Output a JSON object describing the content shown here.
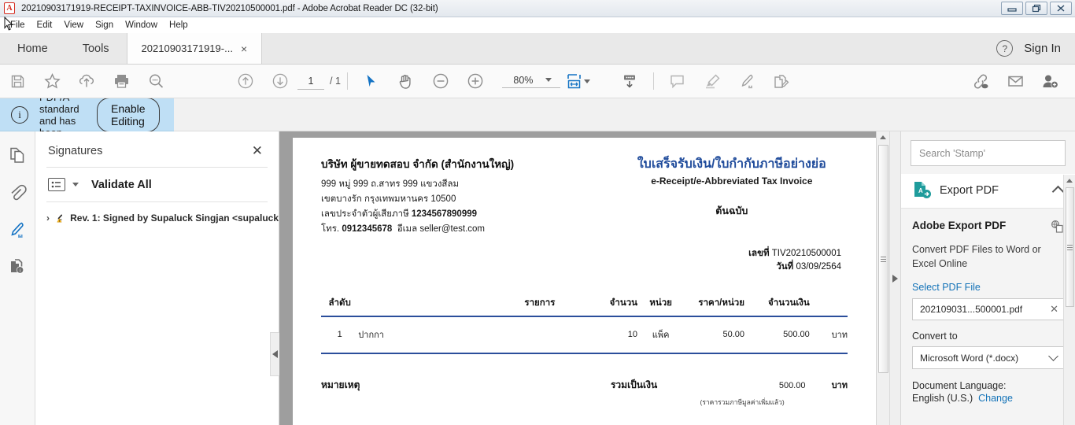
{
  "window": {
    "title": "20210903171919-RECEIPT-TAXINVOICE-ABB-TIV20210500001.pdf - Adobe Acrobat Reader DC (32-bit)",
    "app_icon": "acrobat-logo",
    "minimize": "minimize-button",
    "restore": "restore-button",
    "close": "close-button"
  },
  "menubar": {
    "items": [
      {
        "label": "File"
      },
      {
        "label": "Edit"
      },
      {
        "label": "View"
      },
      {
        "label": "Sign"
      },
      {
        "label": "Window"
      },
      {
        "label": "Help"
      }
    ]
  },
  "tabbar": {
    "home": "Home",
    "tools": "Tools",
    "doc_tab": "20210903171919-...",
    "doc_tab_close": "×",
    "help": "?",
    "sign_in": "Sign In"
  },
  "toolbar": {
    "page_current": "1",
    "page_total": "/ 1",
    "zoom_level": "80%",
    "icons": [
      "save-icon",
      "star-icon",
      "upload-cloud-icon",
      "print-icon",
      "search-icon",
      "previous-page-icon",
      "next-page-icon",
      "select-tool-icon",
      "hand-tool-icon",
      "zoom-out-icon",
      "zoom-in-icon",
      "fit-page-icon",
      "download-icon",
      "comment-icon",
      "highlight-icon",
      "sign-icon",
      "request-signature-icon",
      "share-link-icon",
      "email-icon",
      "add-person-icon"
    ]
  },
  "notification": {
    "message": "This file claims compliance with the PDF/A standard and has been opened read-only to prevent modification.",
    "button": "Enable Editing",
    "icon": "info-icon",
    "background": "#bfdff5"
  },
  "rail": {
    "items": [
      {
        "name": "page-thumbnails-icon",
        "active": false
      },
      {
        "name": "attachments-icon",
        "active": false
      },
      {
        "name": "signatures-icon",
        "active": true
      },
      {
        "name": "document-info-icon",
        "active": false
      }
    ]
  },
  "signatures_panel": {
    "title": "Signatures",
    "close": "✕",
    "validate_all": "Validate All",
    "expander": "›",
    "entry": "Rev. 1: Signed by Supaluck Singjan <supaluck"
  },
  "document": {
    "seller": {
      "name": "บริษัท ผู้ขายทดสอบ จำกัด (สำนักงานใหญ่)",
      "address_line1": "999 หมู่ 999 ถ.สาทร 999 แขวงสีลม",
      "address_line2": "เขตบางรัก กรุงเทพมหานคร 10500",
      "tax_id_label": "เลขประจำตัวผู้เสียภาษี",
      "tax_id": "1234567890999",
      "phone_label": "โทร.",
      "phone": "0912345678",
      "email_label": "อีเมล",
      "email": "seller@test.com"
    },
    "header": {
      "title_th": "ใบเสร็จรับเงิน/ใบกำกับภาษีอย่างย่อ",
      "title_en": "e-Receipt/e-Abbreviated Tax Invoice",
      "original": "ต้นฉบับ",
      "doc_no_label": "เลขที่",
      "doc_no": "TIV20210500001",
      "date_label": "วันที่",
      "date": "03/09/2564"
    },
    "table": {
      "headers": {
        "no": "ลำดับ",
        "description": "รายการ",
        "quantity": "จำนวน",
        "unit": "หน่วย",
        "price_per_unit": "ราคา/หน่วย",
        "amount": "จำนวนเงิน"
      },
      "rows": [
        {
          "no": "1",
          "description": "ปากกา",
          "quantity": "10",
          "unit": "แพ็ค",
          "price_per_unit": "50.00",
          "amount": "500.00",
          "currency": "บาท"
        }
      ]
    },
    "footer": {
      "note_label": "หมายเหตุ",
      "total_label": "รวมเป็นเงิน",
      "total_value": "500.00",
      "total_currency": "บาท",
      "vat_note": "(ราคารวมภาษีมูลค่าเพิ่มแล้ว)"
    }
  },
  "right_pane": {
    "search_placeholder": "Search 'Stamp'",
    "export_pdf_header": "Export PDF",
    "export_icon": "export-pdf-icon",
    "adobe_export_title": "Adobe Export PDF",
    "copy_icon": "copy-icon",
    "description": "Convert PDF Files to Word or Excel Online",
    "select_pdf_file_label": "Select PDF File",
    "selected_file": "202109031...500001.pdf",
    "file_clear": "✕",
    "convert_to_label": "Convert to",
    "convert_to_value": "Microsoft Word (*.docx)",
    "document_language_label": "Document Language:",
    "document_language_value": "English (U.S.)",
    "change_link": "Change"
  },
  "colors": {
    "accent_blue": "#1f4b9b",
    "link_blue": "#1473b8",
    "notify_bg": "#bfdff5",
    "table_rule": "#2b4e9b"
  }
}
